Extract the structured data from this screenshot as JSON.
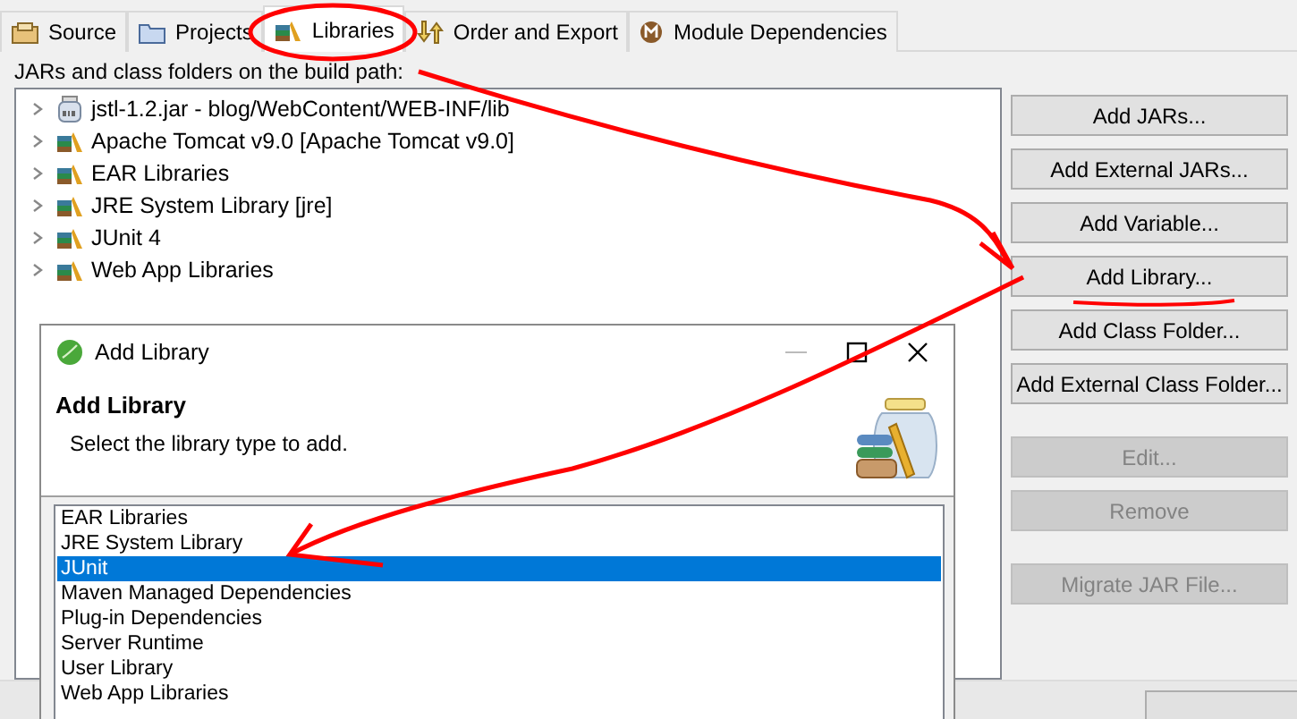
{
  "tabs": [
    {
      "label": "Source",
      "kind": "source",
      "selected": false
    },
    {
      "label": "Projects",
      "kind": "projects",
      "selected": false
    },
    {
      "label": "Libraries",
      "kind": "libraries",
      "selected": true
    },
    {
      "label": "Order and Export",
      "kind": "order",
      "selected": false
    },
    {
      "label": "Module Dependencies",
      "kind": "module",
      "selected": false
    }
  ],
  "build_path_label": "JARs and class folders on the build path:",
  "tree": [
    {
      "label": "jstl-1.2.jar - blog/WebContent/WEB-INF/lib",
      "kind": "jar",
      "expanded": false
    },
    {
      "label": "Apache Tomcat v9.0 [Apache Tomcat v9.0]",
      "kind": "library",
      "expanded": false
    },
    {
      "label": "EAR Libraries",
      "kind": "library",
      "expanded": false
    },
    {
      "label": "JRE System Library [jre]",
      "kind": "library",
      "expanded": false
    },
    {
      "label": "JUnit 4",
      "kind": "library",
      "expanded": false
    },
    {
      "label": "Web App Libraries",
      "kind": "library",
      "expanded": false
    }
  ],
  "button_groups": [
    [
      {
        "label": "Add JARs...",
        "disabled": false
      },
      {
        "label": "Add External JARs...",
        "disabled": false
      },
      {
        "label": "Add Variable...",
        "disabled": false
      },
      {
        "label": "Add Library...",
        "disabled": false
      },
      {
        "label": "Add Class Folder...",
        "disabled": false
      },
      {
        "label": "Add External Class Folder...",
        "disabled": false
      }
    ],
    [
      {
        "label": "Edit...",
        "disabled": true
      },
      {
        "label": "Remove",
        "disabled": true
      }
    ],
    [
      {
        "label": "Migrate JAR File...",
        "disabled": true
      }
    ]
  ],
  "dialog": {
    "title": "Add Library",
    "heading": "Add Library",
    "description": "Select the library type to add.",
    "items": [
      {
        "label": "EAR Libraries",
        "selected": false
      },
      {
        "label": "JRE System Library",
        "selected": false
      },
      {
        "label": "JUnit",
        "selected": true
      },
      {
        "label": "Maven Managed Dependencies",
        "selected": false
      },
      {
        "label": "Plug-in Dependencies",
        "selected": false
      },
      {
        "label": "Server Runtime",
        "selected": false
      },
      {
        "label": "User Library",
        "selected": false
      },
      {
        "label": "Web App Libraries",
        "selected": false
      }
    ]
  }
}
